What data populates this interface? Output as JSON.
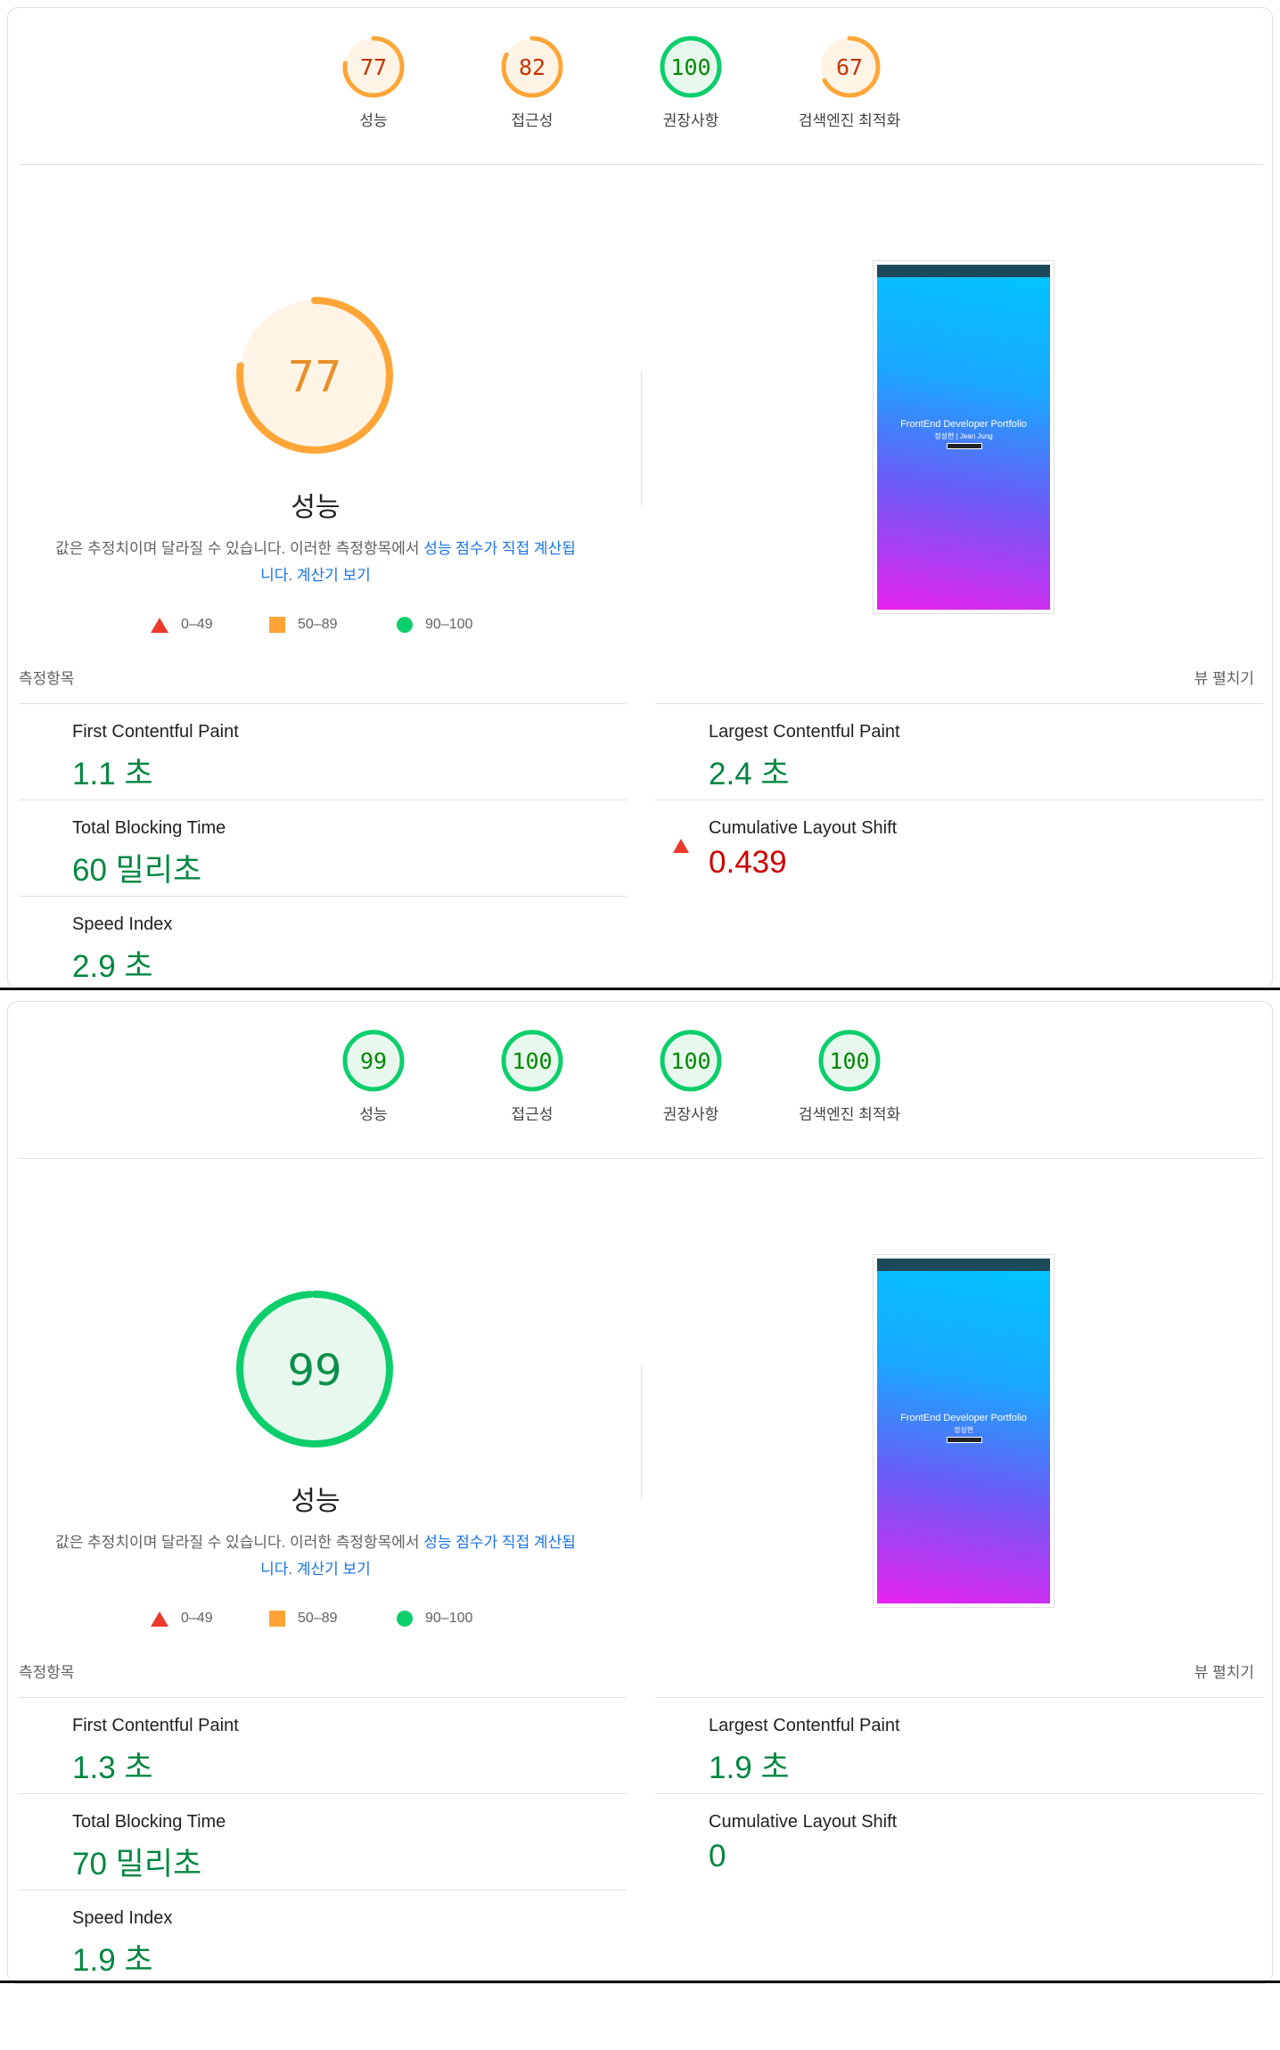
{
  "reports": [
    {
      "gauges": [
        {
          "score": "77",
          "label": "성능",
          "color": "#ffa537",
          "fill": 0.77
        },
        {
          "score": "82",
          "label": "접근성",
          "color": "#ffa537",
          "fill": 0.82
        },
        {
          "score": "100",
          "label": "권장사항",
          "color": "#0cce6b",
          "fill": 1.0
        },
        {
          "score": "67",
          "label": "검색엔진 최적화",
          "color": "#ffa537",
          "fill": 0.67
        }
      ],
      "main": {
        "score": "77",
        "title": "성능",
        "color": "#ffa537",
        "fill": 0.77,
        "desc_plain": "값은 추정치이며 달라질 수 있습니다. 이러한 측정항목에서 ",
        "desc_link1": "성능 점수가 직접 계산됩니다",
        "desc_after": ". ",
        "desc_link2": "계산기 보기"
      },
      "legend": [
        "0–49",
        "50–89",
        "90–100"
      ],
      "screenshot": {
        "title": "FrontEnd Developer Portfolio",
        "subtitle": "정성현 | Jean Jung"
      },
      "metrics_header": {
        "left": "측정항목",
        "right": "뷰 펼치기"
      },
      "metrics": [
        {
          "name": "First Contentful Paint",
          "value": "1.1 초",
          "status": "good"
        },
        {
          "name": "Largest Contentful Paint",
          "value": "2.4 초",
          "status": "good"
        },
        {
          "name": "Total Blocking Time",
          "value": "60 밀리초",
          "status": "good"
        },
        {
          "name": "Cumulative Layout Shift",
          "value": "0.439",
          "status": "bad"
        },
        {
          "name": "Speed Index",
          "value": "2.9 초",
          "status": "good"
        }
      ]
    },
    {
      "gauges": [
        {
          "score": "99",
          "label": "성능",
          "color": "#0cce6b",
          "fill": 0.99
        },
        {
          "score": "100",
          "label": "접근성",
          "color": "#0cce6b",
          "fill": 1.0
        },
        {
          "score": "100",
          "label": "권장사항",
          "color": "#0cce6b",
          "fill": 1.0
        },
        {
          "score": "100",
          "label": "검색엔진 최적화",
          "color": "#0cce6b",
          "fill": 1.0
        }
      ],
      "main": {
        "score": "99",
        "title": "성능",
        "color": "#0cce6b",
        "fill": 0.99,
        "desc_plain": "값은 추정치이며 달라질 수 있습니다. 이러한 측정항목에서 ",
        "desc_link1": "성능 점수가 직접 계산됩니다",
        "desc_after": ". ",
        "desc_link2": "계산기 보기"
      },
      "legend": [
        "0–49",
        "50–89",
        "90–100"
      ],
      "screenshot": {
        "title": "FrontEnd Developer Portfolio",
        "subtitle": "정성현"
      },
      "metrics_header": {
        "left": "측정항목",
        "right": "뷰 펼치기"
      },
      "metrics": [
        {
          "name": "First Contentful Paint",
          "value": "1.3 초",
          "status": "good"
        },
        {
          "name": "Largest Contentful Paint",
          "value": "1.9 초",
          "status": "good"
        },
        {
          "name": "Total Blocking Time",
          "value": "70 밀리초",
          "status": "good"
        },
        {
          "name": "Cumulative Layout Shift",
          "value": "0",
          "status": "good"
        },
        {
          "name": "Speed Index",
          "value": "1.9 초",
          "status": "good"
        }
      ]
    }
  ]
}
